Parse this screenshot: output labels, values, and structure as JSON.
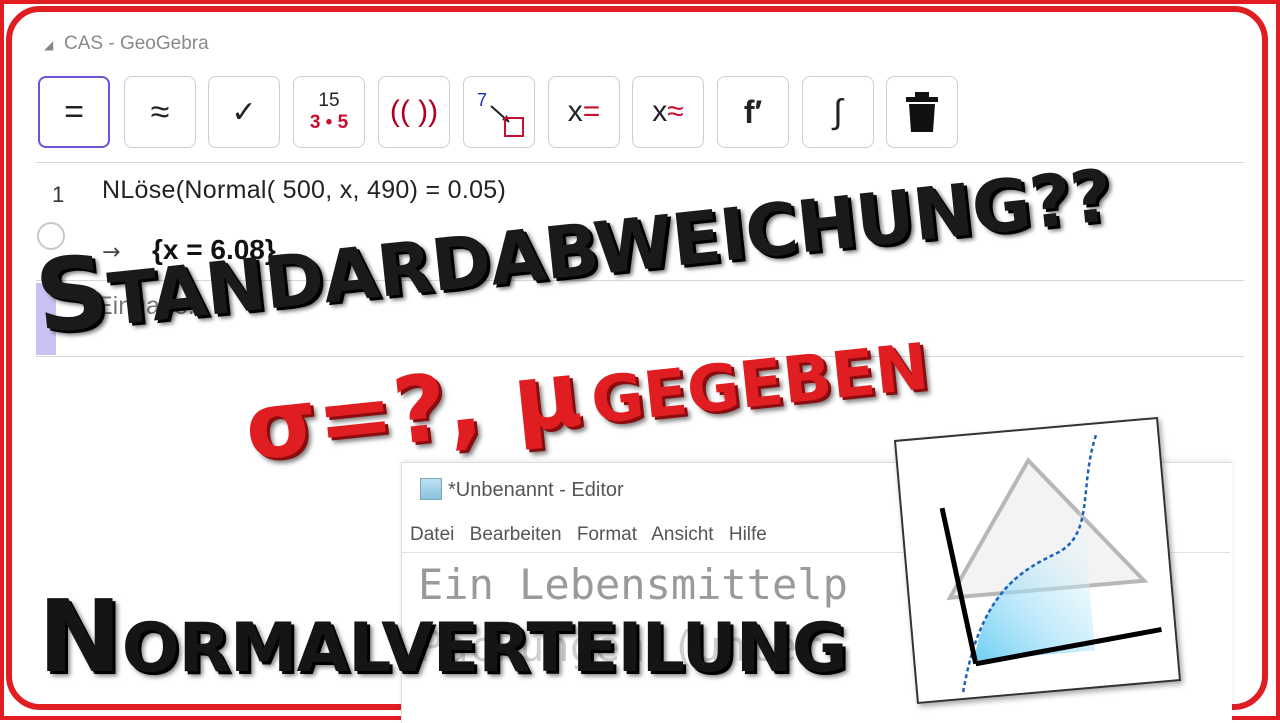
{
  "window": {
    "title": "CAS - GeoGebra"
  },
  "toolbar": {
    "buttons": [
      {
        "label": "=",
        "name": "evaluate-button"
      },
      {
        "label": "≈",
        "name": "numeric-button"
      },
      {
        "label": "✓",
        "name": "keep-input-button"
      },
      {
        "label_top": "15",
        "label_bottom": "3 • 5",
        "name": "factor-button"
      },
      {
        "label": "(( ))",
        "name": "expand-button"
      },
      {
        "label": "7",
        "name": "substitute-button"
      },
      {
        "label_x": "x",
        "label_op": "=",
        "name": "solve-button"
      },
      {
        "label_x": "x",
        "label_op": "≈",
        "name": "solve-numerically-button"
      },
      {
        "label": "f′",
        "name": "derivative-button"
      },
      {
        "label": "∫",
        "name": "integral-button"
      },
      {
        "icon": "trash-icon",
        "name": "delete-button"
      }
    ],
    "accent": "#6557d2"
  },
  "cas": {
    "row1": {
      "number": "1",
      "input": "NLöse(Normal( 500,  x,  490)  =  0.05)",
      "arrow": "→",
      "result": "{x = 6.08}"
    },
    "row2": {
      "number": "2",
      "placeholder": "Eingabe..."
    }
  },
  "editor": {
    "title": "*Unbenannt - Editor",
    "menu": [
      "Datei",
      "Bearbeiten",
      "Format",
      "Ansicht",
      "Hilfe"
    ],
    "line1": "Ein Lebensmittelp",
    "line2": "Packungen (unter"
  },
  "overlay": {
    "headline_first": "S",
    "headline_rest": "TANDARDABWEICHUNG??",
    "sub_a": "σ=?, μ",
    "sub_b": "GEGEBEN",
    "bottom_first": "N",
    "bottom_rest": "ORMALVERTEILUNG"
  },
  "colors": {
    "frame": "#e01e22",
    "sub_text": "#e01e22",
    "headline": "#1a1a1a"
  }
}
